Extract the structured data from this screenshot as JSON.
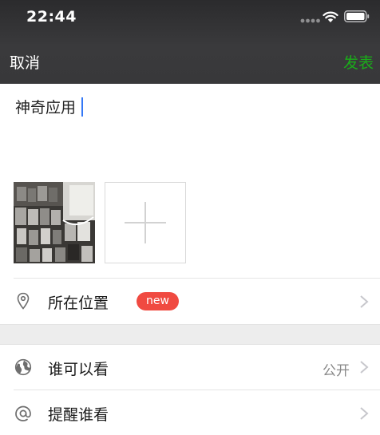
{
  "status_bar": {
    "time": "22:44"
  },
  "nav": {
    "cancel_label": "取消",
    "publish_label": "发表"
  },
  "compose": {
    "text": "神奇应用"
  },
  "options": {
    "location": {
      "label": "所在位置",
      "badge": "new",
      "icon": "location-pin-icon"
    },
    "visibility": {
      "label": "谁可以看",
      "value": "公开",
      "icon": "globe-icon"
    },
    "mention": {
      "label": "提醒谁看",
      "icon": "at-sign-icon"
    }
  },
  "colors": {
    "publish_green": "#1aad19",
    "badge_red": "#f04a41",
    "caret_blue": "#3478f6"
  }
}
